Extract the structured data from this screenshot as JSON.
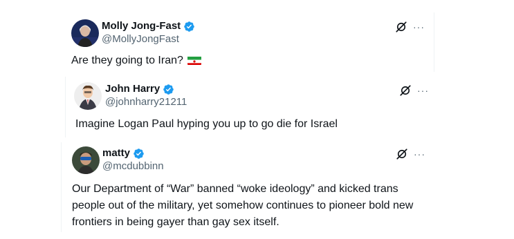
{
  "tweets": [
    {
      "name": "Molly Jong-Fast",
      "handle": "@MollyJongFast",
      "text": "Are they going to Iran?",
      "emoji": "iran-flag"
    },
    {
      "name": "John Harry",
      "handle": "@johnharry21211",
      "text": "Imagine Logan Paul hyping you up to go die for Israel"
    },
    {
      "name": "matty",
      "handle": "@mcdubbinn",
      "text_lines": [
        "Our Department of “War” banned “woke ideology” and kicked trans",
        "people out of the military, yet somehow continues to pioneer bold new",
        "frontiers in being gayer than gay sex itself."
      ]
    }
  ],
  "icons": {
    "verified": "verified-badge-icon",
    "grok": "grok-icon",
    "more": "more-icon"
  },
  "colors": {
    "verified": "#1d9bf0",
    "text": "#0f1419",
    "secondary": "#536471"
  },
  "more_glyph": "···"
}
